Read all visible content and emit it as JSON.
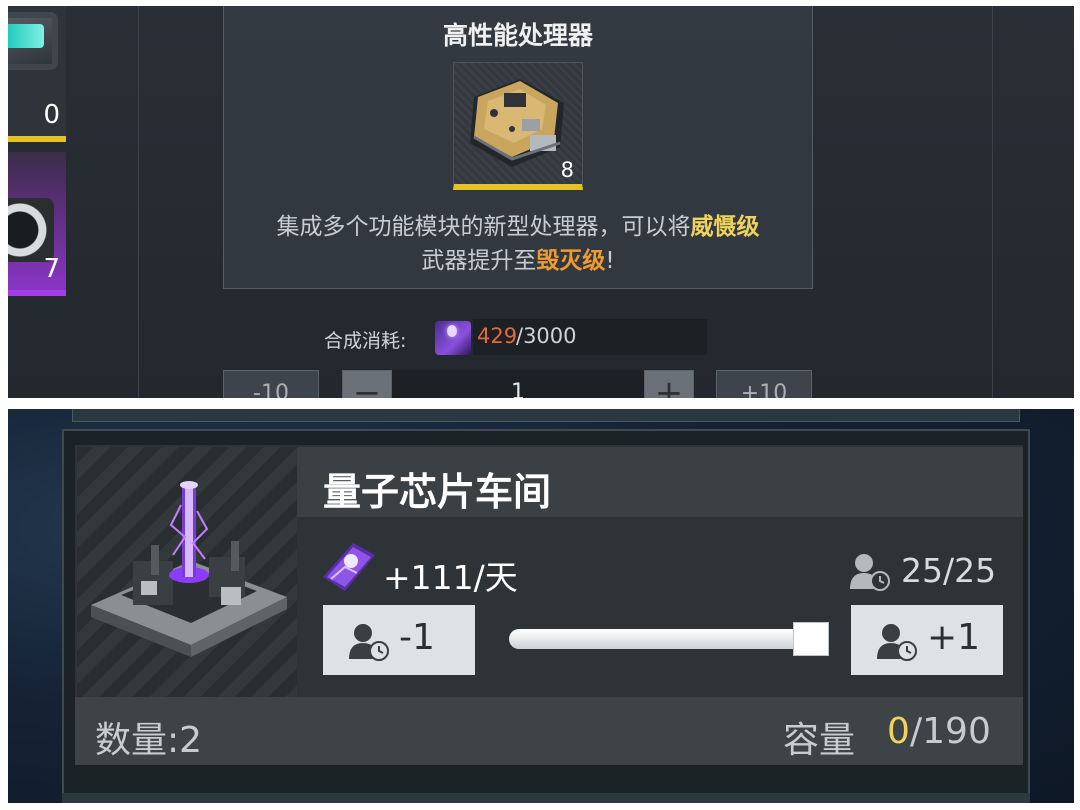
{
  "top_panel": {
    "side_slots": [
      {
        "count": "0",
        "rarity_color": "#e6c227"
      },
      {
        "count": "7",
        "rarity_color": "#a23ee6"
      }
    ],
    "item": {
      "title": "高性能处理器",
      "quantity": "8",
      "rarity_color": "#e6c227",
      "description": {
        "part1": "集成多个功能模块的新型处理器，可以将",
        "highlight1": "威慑级",
        "part2": "武器提升至",
        "highlight2": "毁灭级",
        "part3": "!"
      }
    },
    "cost": {
      "label": "合成消耗:",
      "have": "429",
      "total": "/3000",
      "have_color": "#e06a3c"
    },
    "quantity_controls": {
      "minus10": "-10",
      "minus": "−",
      "value": "1",
      "plus": "+",
      "plus10": "+10"
    }
  },
  "bottom_panel": {
    "building": {
      "title": "量子芯片车间",
      "production_rate": "+111/天",
      "workers": "25/25",
      "worker_slider_fraction": 1.0,
      "decrement_label": "-1",
      "increment_label": "+1",
      "quantity_label": "数量:2",
      "capacity_label": "容量",
      "capacity_used": "0",
      "capacity_total": "/190"
    }
  }
}
